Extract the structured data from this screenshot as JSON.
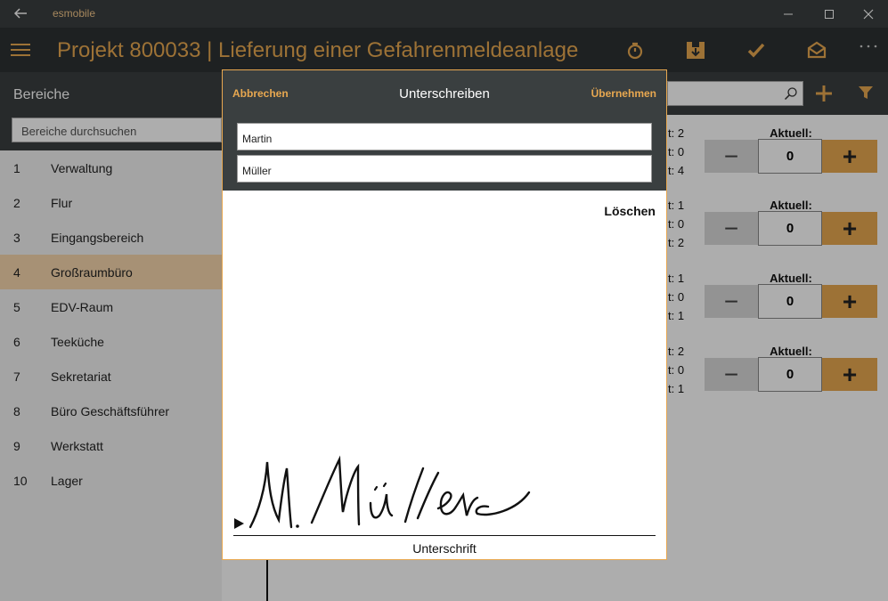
{
  "titlebar": {
    "app_name": "esmobile"
  },
  "header": {
    "title": "Projekt 800033  |  Lieferung einer Gefahrenmeldeanlage"
  },
  "sidebar": {
    "heading": "Bereiche",
    "search_placeholder": "Bereiche durchsuchen",
    "items": [
      {
        "num": "1",
        "label": "Verwaltung"
      },
      {
        "num": "2",
        "label": "Flur"
      },
      {
        "num": "3",
        "label": "Eingangsbereich"
      },
      {
        "num": "4",
        "label": "Großraumbüro"
      },
      {
        "num": "5",
        "label": "EDV-Raum"
      },
      {
        "num": "6",
        "label": "Teeküche"
      },
      {
        "num": "7",
        "label": "Sekretariat"
      },
      {
        "num": "8",
        "label": "Büro Geschäftsführer"
      },
      {
        "num": "9",
        "label": "Werkstatt"
      },
      {
        "num": "10",
        "label": "Lager"
      }
    ],
    "selected_index": 3
  },
  "content": {
    "counters": [
      {
        "label": "Aktuell:",
        "value": "0",
        "minus": "−",
        "plus": "+",
        "stats": [
          "t: 2",
          "t: 0",
          "t: 4"
        ]
      },
      {
        "label": "Aktuell:",
        "value": "0",
        "minus": "−",
        "plus": "+",
        "stats": [
          "t: 1",
          "t: 0",
          "t: 2"
        ]
      },
      {
        "label": "Aktuell:",
        "value": "0",
        "minus": "−",
        "plus": "+",
        "stats": [
          "t: 1",
          "t: 0",
          "t: 1"
        ]
      },
      {
        "label": "Aktuell:",
        "value": "0",
        "minus": "−",
        "plus": "+",
        "stats": [
          "t: 2",
          "t: 0",
          "t: 1"
        ]
      }
    ]
  },
  "modal": {
    "cancel_label": "Abbrechen",
    "title": "Unterschreiben",
    "apply_label": "Übernehmen",
    "first_name": "Martin",
    "last_name": "Müller",
    "clear_label": "Löschen",
    "signature_label": "Unterschrift"
  },
  "colors": {
    "accent": "#e8a850",
    "dark": "#3a3f40",
    "selected": "#f7d6ad"
  }
}
